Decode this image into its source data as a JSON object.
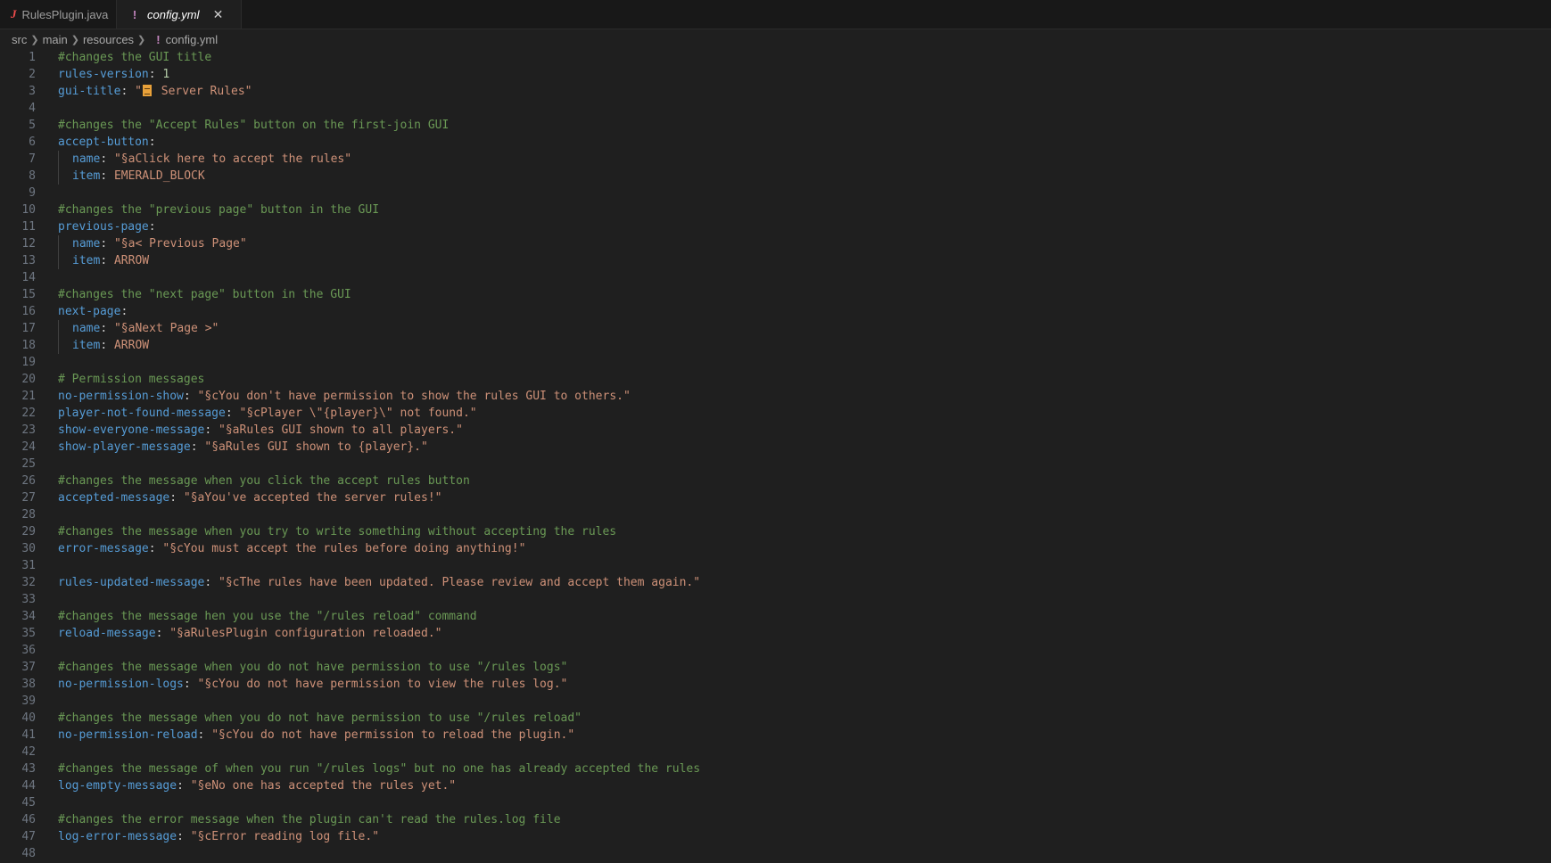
{
  "tabs": [
    {
      "label": "RulesPlugin.java",
      "icon": "java-file-icon",
      "active": false
    },
    {
      "label": "config.yml",
      "icon": "yaml-file-icon",
      "active": true,
      "close": "✕"
    }
  ],
  "breadcrumb": [
    "src",
    "main",
    "resources",
    "config.yml"
  ],
  "lines": [
    {
      "n": "1",
      "comment": "#changes the GUI title"
    },
    {
      "n": "2",
      "key": "rules-version",
      "num": "1"
    },
    {
      "n": "3",
      "key": "gui-title",
      "pre": "\"",
      "emoji": true,
      "str": " Server Rules\""
    },
    {
      "n": "4"
    },
    {
      "n": "5",
      "comment": "#changes the \"Accept Rules\" button on the first-join GUI"
    },
    {
      "n": "6",
      "key": "accept-button",
      "colon_only": true
    },
    {
      "n": "7",
      "indent": 1,
      "key": "name",
      "str": "\"§aClick here to accept the rules\""
    },
    {
      "n": "8",
      "indent": 1,
      "key": "item",
      "plain": "EMERALD_BLOCK"
    },
    {
      "n": "9"
    },
    {
      "n": "10",
      "comment": "#changes the \"previous page\" button in the GUI"
    },
    {
      "n": "11",
      "key": "previous-page",
      "colon_only": true
    },
    {
      "n": "12",
      "indent": 1,
      "key": "name",
      "str": "\"§a< Previous Page\""
    },
    {
      "n": "13",
      "indent": 1,
      "key": "item",
      "plain": "ARROW"
    },
    {
      "n": "14"
    },
    {
      "n": "15",
      "comment": "#changes the \"next page\" button in the GUI"
    },
    {
      "n": "16",
      "key": "next-page",
      "colon_only": true
    },
    {
      "n": "17",
      "indent": 1,
      "key": "name",
      "str": "\"§aNext Page >\""
    },
    {
      "n": "18",
      "indent": 1,
      "key": "item",
      "plain": "ARROW"
    },
    {
      "n": "19"
    },
    {
      "n": "20",
      "comment": "# Permission messages"
    },
    {
      "n": "21",
      "key": "no-permission-show",
      "str": "\"§cYou don't have permission to show the rules GUI to others.\""
    },
    {
      "n": "22",
      "key": "player-not-found-message",
      "str": "\"§cPlayer \\\"{player}\\\" not found.\""
    },
    {
      "n": "23",
      "key": "show-everyone-message",
      "str": "\"§aRules GUI shown to all players.\""
    },
    {
      "n": "24",
      "key": "show-player-message",
      "str": "\"§aRules GUI shown to {player}.\""
    },
    {
      "n": "25"
    },
    {
      "n": "26",
      "comment": "#changes the message when you click the accept rules button"
    },
    {
      "n": "27",
      "key": "accepted-message",
      "str": "\"§aYou've accepted the server rules!\""
    },
    {
      "n": "28"
    },
    {
      "n": "29",
      "comment": "#changes the message when you try to write something without accepting the rules"
    },
    {
      "n": "30",
      "key": "error-message",
      "str": "\"§cYou must accept the rules before doing anything!\""
    },
    {
      "n": "31"
    },
    {
      "n": "32",
      "key": "rules-updated-message",
      "str": "\"§cThe rules have been updated. Please review and accept them again.\""
    },
    {
      "n": "33"
    },
    {
      "n": "34",
      "comment": "#changes the message hen you use the \"/rules reload\" command"
    },
    {
      "n": "35",
      "key": "reload-message",
      "str": "\"§aRulesPlugin configuration reloaded.\""
    },
    {
      "n": "36"
    },
    {
      "n": "37",
      "comment": "#changes the message when you do not have permission to use \"/rules logs\""
    },
    {
      "n": "38",
      "key": "no-permission-logs",
      "str": "\"§cYou do not have permission to view the rules log.\""
    },
    {
      "n": "39"
    },
    {
      "n": "40",
      "comment": "#changes the message when you do not have permission to use \"/rules reload\""
    },
    {
      "n": "41",
      "key": "no-permission-reload",
      "str": "\"§cYou do not have permission to reload the plugin.\""
    },
    {
      "n": "42"
    },
    {
      "n": "43",
      "comment": "#changes the message of when you run \"/rules logs\" but no one has already accepted the rules"
    },
    {
      "n": "44",
      "key": "log-empty-message",
      "str": "\"§eNo one has accepted the rules yet.\""
    },
    {
      "n": "45"
    },
    {
      "n": "46",
      "comment": "#changes the error message when the plugin can't read the rules.log file"
    },
    {
      "n": "47",
      "key": "log-error-message",
      "str": "\"§cError reading log file.\""
    },
    {
      "n": "48"
    }
  ]
}
